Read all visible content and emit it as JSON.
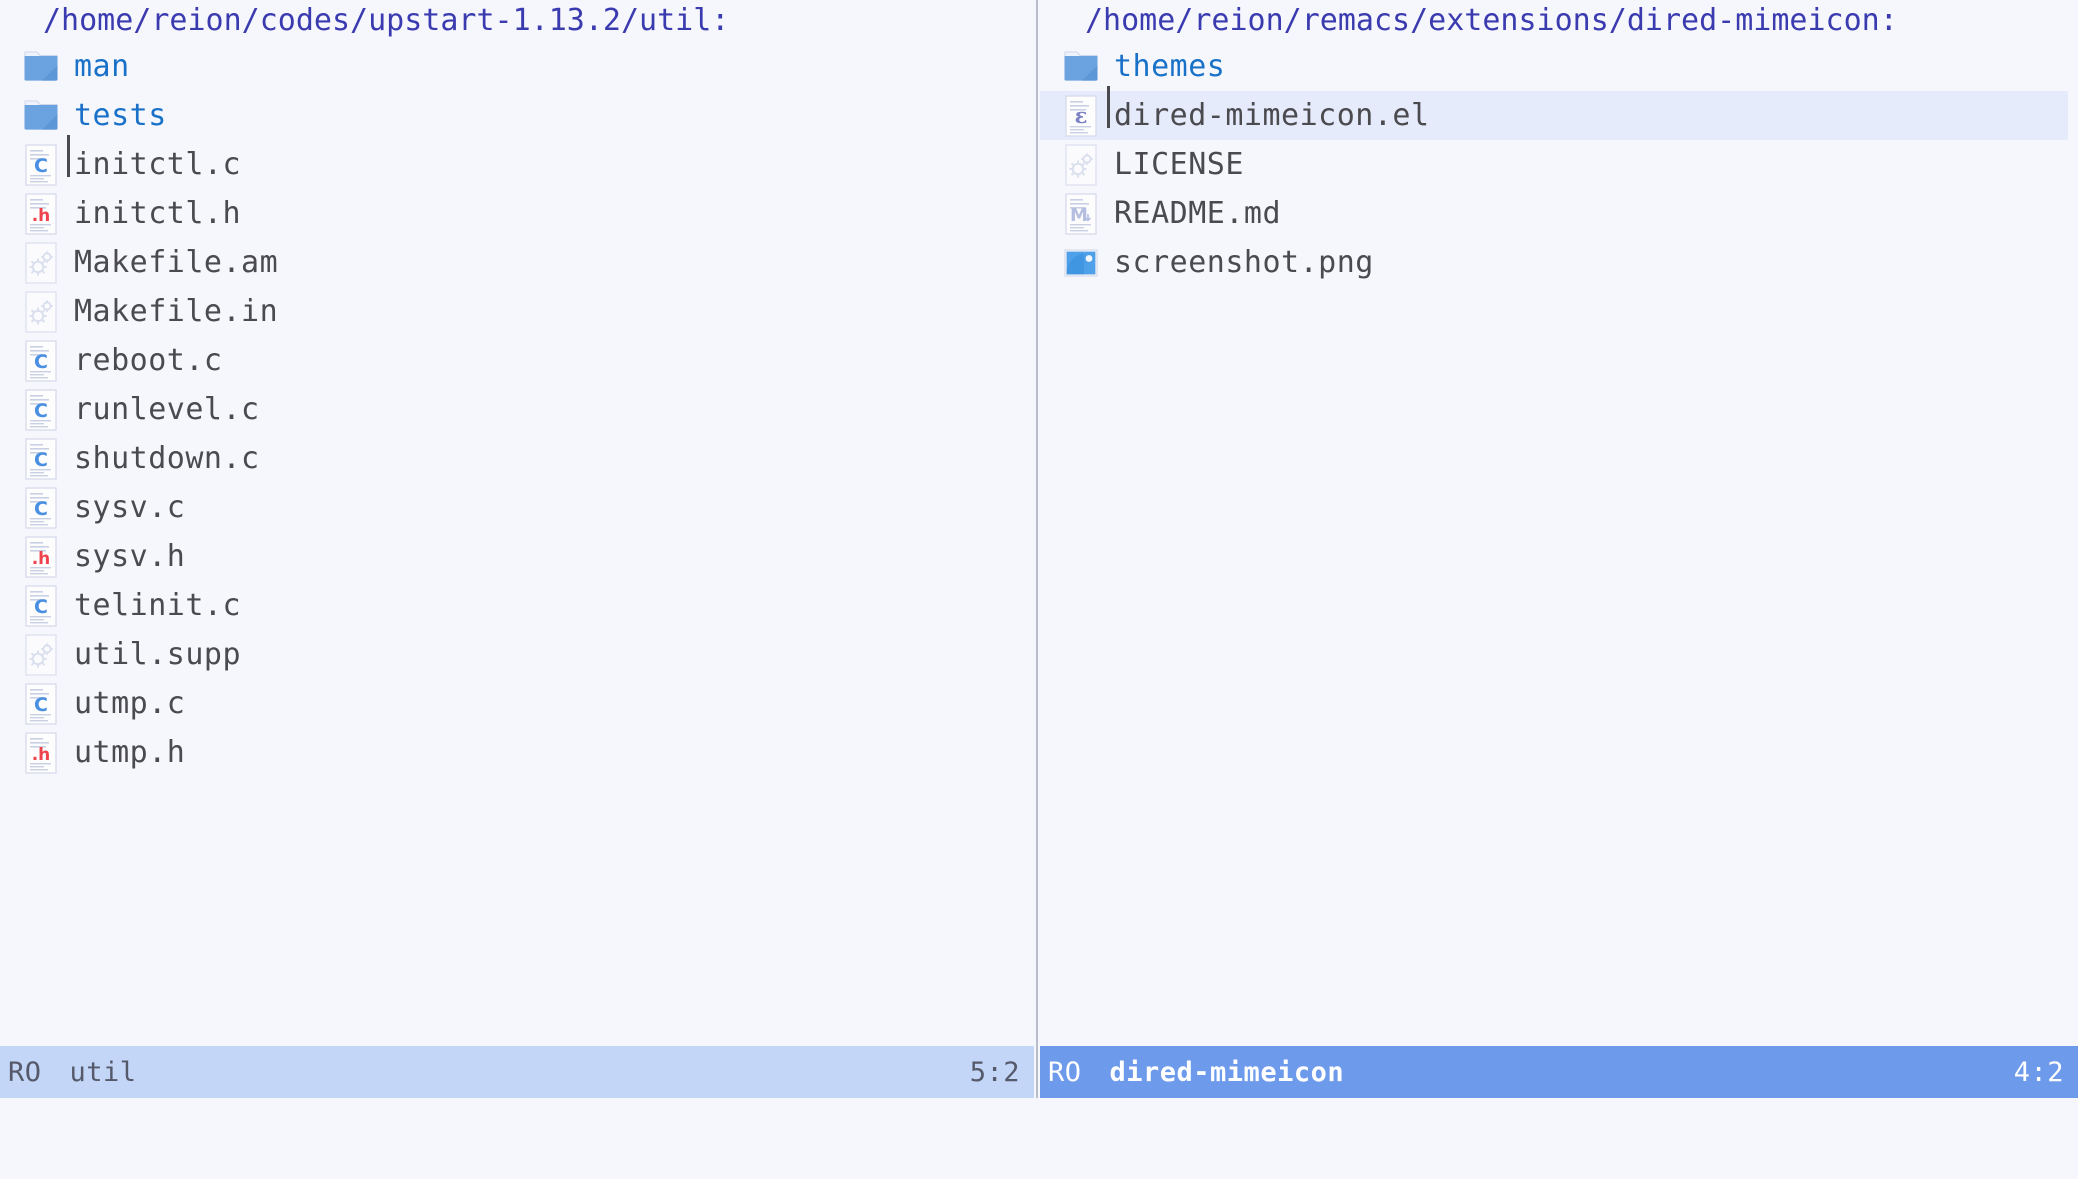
{
  "app": {
    "background": "#f6f7fd",
    "accent_blue": "#6d9aea",
    "dir_text_color": "#1a72c8",
    "path_color": "#3b3bb0",
    "file_text_color": "#4a4a4f",
    "selection_color": "#e5ebfa",
    "modeline_inactive_bg": "#c3d6f7",
    "modeline_active_bg": "#6d9aea"
  },
  "panes": [
    {
      "id": "left",
      "path": "/home/reion/codes/upstart-1.13.2/util:",
      "entries": [
        {
          "name": "man",
          "icon": "folder-icon",
          "type": "dir",
          "selected": false,
          "cursor": false
        },
        {
          "name": "tests",
          "icon": "folder-icon",
          "type": "dir",
          "selected": false,
          "cursor": false
        },
        {
          "name": "initctl.c",
          "icon": "c-source-icon",
          "type": "file",
          "selected": false,
          "cursor": true
        },
        {
          "name": "initctl.h",
          "icon": "c-header-icon",
          "type": "file",
          "selected": false,
          "cursor": false
        },
        {
          "name": "Makefile.am",
          "icon": "gears-icon",
          "type": "file",
          "selected": false,
          "cursor": false
        },
        {
          "name": "Makefile.in",
          "icon": "gears-icon",
          "type": "file",
          "selected": false,
          "cursor": false
        },
        {
          "name": "reboot.c",
          "icon": "c-source-icon",
          "type": "file",
          "selected": false,
          "cursor": false
        },
        {
          "name": "runlevel.c",
          "icon": "c-source-icon",
          "type": "file",
          "selected": false,
          "cursor": false
        },
        {
          "name": "shutdown.c",
          "icon": "c-source-icon",
          "type": "file",
          "selected": false,
          "cursor": false
        },
        {
          "name": "sysv.c",
          "icon": "c-source-icon",
          "type": "file",
          "selected": false,
          "cursor": false
        },
        {
          "name": "sysv.h",
          "icon": "c-header-icon",
          "type": "file",
          "selected": false,
          "cursor": false
        },
        {
          "name": "telinit.c",
          "icon": "c-source-icon",
          "type": "file",
          "selected": false,
          "cursor": false
        },
        {
          "name": "util.supp",
          "icon": "gears-icon",
          "type": "file",
          "selected": false,
          "cursor": false
        },
        {
          "name": "utmp.c",
          "icon": "c-source-icon",
          "type": "file",
          "selected": false,
          "cursor": false
        },
        {
          "name": "utmp.h",
          "icon": "c-header-icon",
          "type": "file",
          "selected": false,
          "cursor": false
        }
      ],
      "modeline": {
        "readonly": "RO",
        "buffer_name": "util",
        "position": "5:2",
        "active": false
      }
    },
    {
      "id": "right",
      "path": "/home/reion/remacs/extensions/dired-mimeicon:",
      "entries": [
        {
          "name": "themes",
          "icon": "folder-icon",
          "type": "dir",
          "selected": false,
          "cursor": false
        },
        {
          "name": "dired-mimeicon.el",
          "icon": "elisp-icon",
          "type": "file",
          "selected": true,
          "cursor": true
        },
        {
          "name": "LICENSE",
          "icon": "gears-icon",
          "type": "file",
          "selected": false,
          "cursor": false
        },
        {
          "name": "README.md",
          "icon": "markdown-icon",
          "type": "file",
          "selected": false,
          "cursor": false
        },
        {
          "name": "screenshot.png",
          "icon": "image-icon",
          "type": "file",
          "selected": false,
          "cursor": false
        }
      ],
      "modeline": {
        "readonly": "RO",
        "buffer_name": "dired-mimeicon",
        "position": "4:2",
        "active": true
      }
    }
  ],
  "echo_area": ""
}
